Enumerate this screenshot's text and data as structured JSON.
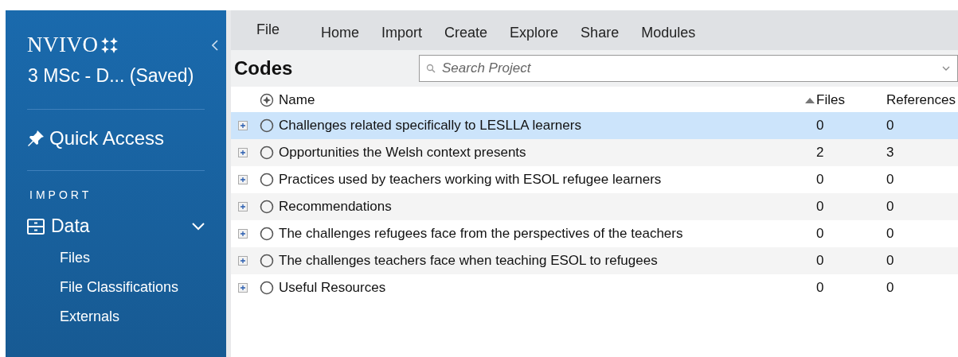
{
  "sidebar": {
    "brand": "NVIVO",
    "project": "3 MSc - D... (Saved)",
    "quick_access": "Quick Access",
    "section": "IMPORT",
    "group": {
      "label": "Data",
      "expanded": true,
      "items": [
        {
          "label": "Files"
        },
        {
          "label": "File Classifications"
        },
        {
          "label": "Externals"
        }
      ]
    }
  },
  "ribbon": {
    "tabs": [
      "File",
      "Home",
      "Import",
      "Create",
      "Explore",
      "Share",
      "Modules"
    ]
  },
  "view": {
    "title": "Codes",
    "search": {
      "placeholder": "Search Project"
    }
  },
  "table": {
    "columns": [
      {
        "label": "Name",
        "sorted": false
      },
      {
        "label": "Files",
        "sorted": true
      },
      {
        "label": "References",
        "sorted": false
      }
    ],
    "rows": [
      {
        "name": "Challenges related specifically to LESLLA learners",
        "files": "0",
        "references": "0",
        "selected": true
      },
      {
        "name": "Opportunities the Welsh context presents",
        "files": "2",
        "references": "3",
        "selected": false
      },
      {
        "name": "Practices used by teachers working with ESOL refugee learners",
        "files": "0",
        "references": "0",
        "selected": false
      },
      {
        "name": "Recommendations",
        "files": "0",
        "references": "0",
        "selected": false
      },
      {
        "name": "The challenges refugees face from the perspectives of the teachers",
        "files": "0",
        "references": "0",
        "selected": false
      },
      {
        "name": "The challenges teachers face when teaching ESOL to refugees",
        "files": "0",
        "references": "0",
        "selected": false
      },
      {
        "name": "Useful Resources",
        "files": "0",
        "references": "0",
        "selected": false
      }
    ]
  }
}
